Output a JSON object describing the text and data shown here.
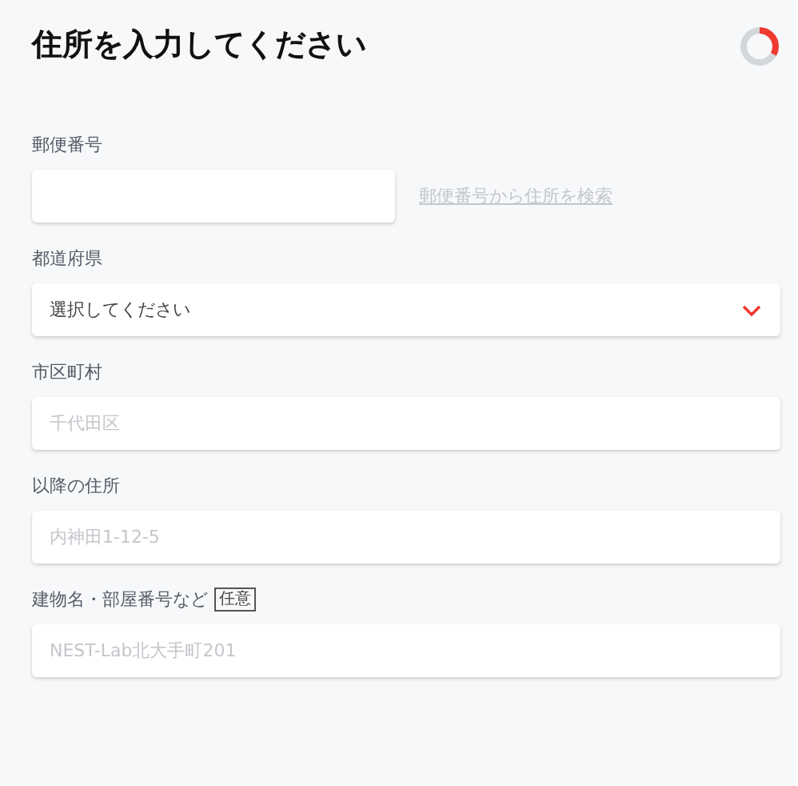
{
  "title": "住所を入力してください",
  "progress": {
    "level": 0.33
  },
  "fields": [
    {
      "kind": "postal",
      "label": "郵便番号",
      "link": "郵便番号から住所を検索"
    },
    {
      "kind": "select",
      "label": "都道府県",
      "value": "選択してください"
    },
    {
      "kind": "text",
      "label": "市区町村",
      "placeholder": "千代田区"
    },
    {
      "kind": "text",
      "label": "以降の住所",
      "placeholder": "内神田1-12-5"
    },
    {
      "kind": "text",
      "label": "建物名・部屋番号など",
      "badge": "任意",
      "placeholder": "NEST-Lab北大手町201"
    }
  ]
}
